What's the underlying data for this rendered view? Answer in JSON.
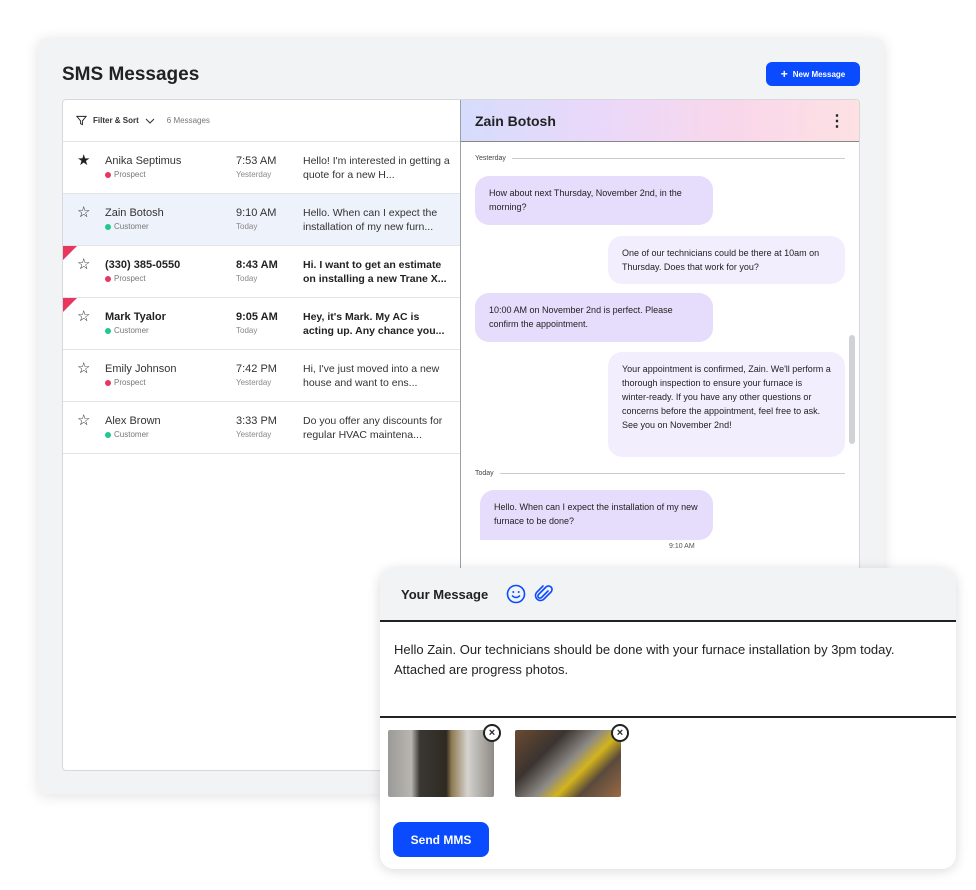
{
  "title": "SMS Messages",
  "new_message_label": "New Message",
  "list": {
    "filter_label": "Filter & Sort",
    "count": "6 Messages",
    "rows": [
      {
        "name": "Anika Septimus",
        "tag": "Prospect",
        "time": "7:53 AM",
        "day": "Yesterday",
        "preview": "Hello! I'm interested in getting a quote for a new H...",
        "starred": true,
        "unread": false,
        "flag": false
      },
      {
        "name": "Zain Botosh",
        "tag": "Customer",
        "time": "9:10 AM",
        "day": "Today",
        "preview": "Hello. When can I expect the installation of my new furn...",
        "starred": false,
        "unread": false,
        "flag": false,
        "selected": true
      },
      {
        "name": "(330) 385-0550",
        "tag": "Prospect",
        "time": "8:43 AM",
        "day": "Today",
        "preview": "Hi. I want to get an estimate on installing a new Trane X...",
        "starred": false,
        "unread": true,
        "flag": true
      },
      {
        "name": "Mark Tyalor",
        "tag": "Customer",
        "time": "9:05 AM",
        "day": "Today",
        "preview": "Hey, it's Mark. My AC is acting up. Any chance you...",
        "starred": false,
        "unread": true,
        "flag": true
      },
      {
        "name": "Emily Johnson",
        "tag": "Prospect",
        "time": "7:42 PM",
        "day": "Yesterday",
        "preview": "Hi, I've just moved into a new house and want to ens...",
        "starred": false,
        "unread": false,
        "flag": false
      },
      {
        "name": "Alex Brown",
        "tag": "Customer",
        "time": "3:33 PM",
        "day": "Yesterday",
        "preview": "Do you offer any discounts for regular HVAC maintena...",
        "starred": false,
        "unread": false,
        "flag": false
      }
    ]
  },
  "colors": {
    "prospect": "#e8375e",
    "customer": "#1fc98a",
    "accent": "#0a4bff"
  },
  "chat": {
    "contact": "Zain Botosh",
    "sep_yesterday": "Yesterday",
    "sep_today": "Today",
    "messages": [
      "How about next Thursday, November 2nd, in the morning?",
      "One of our technicians could be there at 10am on Thursday.  Does that work for you?",
      "10:00 AM on November 2nd is perfect. Please confirm the appointment.",
      "Your appointment is confirmed, Zain. We'll perform a thorough inspection to ensure your furnace is winter-ready.  If you have any other questions or concerns before the appointment, feel free to ask. See you on November 2nd!",
      "Hello. When can I expect the installation of my new furnace to be done?"
    ],
    "last_time": "9:10 AM"
  },
  "composer": {
    "label": "Your Message",
    "text": "Hello Zain. Our technicians should be done with your furnace installation by 3pm today. Attached are progress photos.",
    "send_label": "Send MMS"
  }
}
